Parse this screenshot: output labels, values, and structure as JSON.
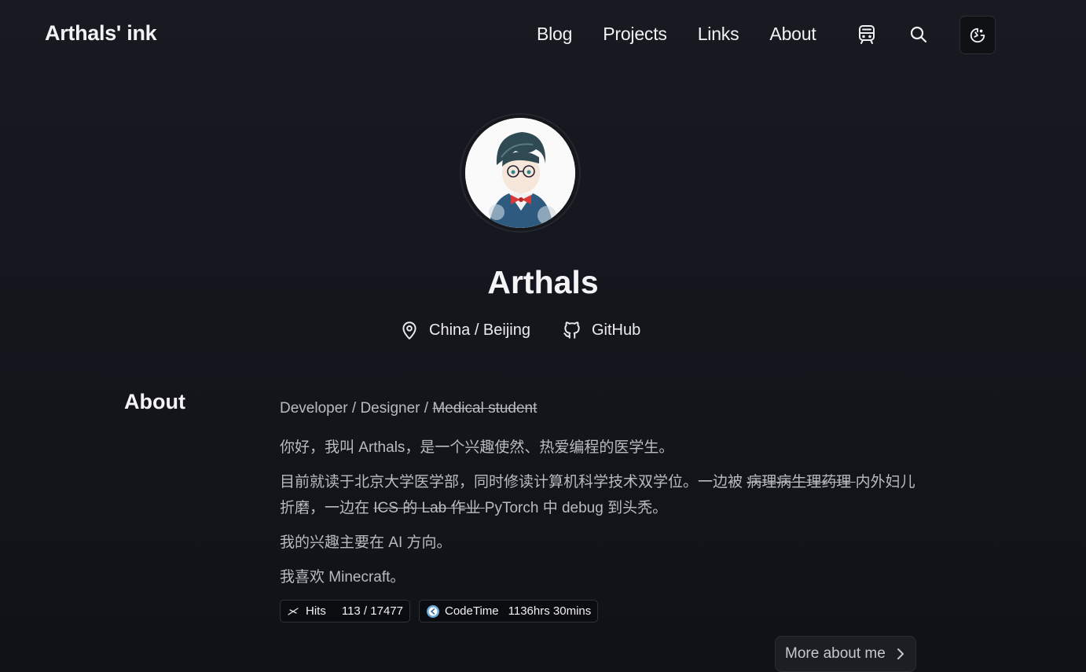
{
  "header": {
    "site_title": "Arthals' ink",
    "nav": [
      "Blog",
      "Projects",
      "Links",
      "About"
    ]
  },
  "icons": {
    "rss": "train-icon",
    "search": "search-icon",
    "theme": "theme-toggle-icon"
  },
  "profile": {
    "name": "Arthals",
    "location": "China / Beijing",
    "github_label": "GitHub"
  },
  "about": {
    "heading": "About",
    "tagline_plain": "Developer / Designer / ",
    "tagline_struck": "Medical student",
    "p1": "你好，我叫 Arthals，是一个兴趣使然、热爱编程的医学生。",
    "p2_a": "目前就读于北京大学医学部，同时修读计算机科学技术双学位。一边被 ",
    "p2_struck1": "病理病生理药理 ",
    "p2_b": "内外妇儿折磨，一边在 ",
    "p2_struck2": "ICS 的 Lab 作业 ",
    "p2_c": "PyTorch 中 debug 到头秃。",
    "p3": "我的兴趣主要在 AI 方向。",
    "p4": "我喜欢 Minecraft。"
  },
  "badges": {
    "hits_label": "Hits",
    "hits_value": "113 / 17477",
    "codetime_label": "CodeTime",
    "codetime_value": "1136hrs 30mins"
  },
  "more_button": "More about me",
  "colors": {
    "background": "#12141a",
    "text": "#e8e8ea",
    "muted": "#b9bbc2"
  }
}
